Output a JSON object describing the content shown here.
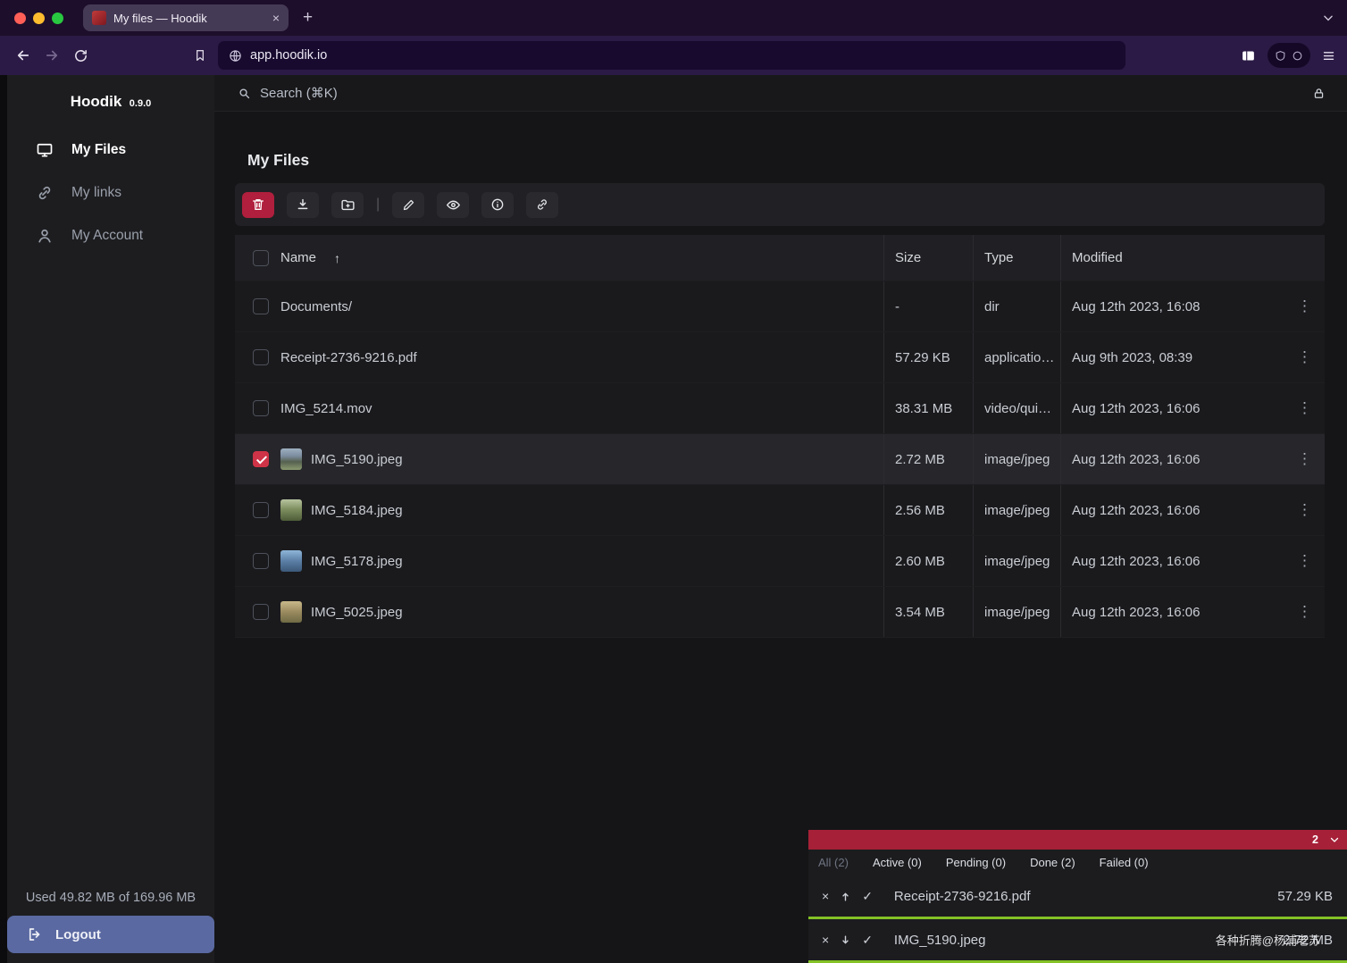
{
  "theme": {
    "delete_red": "#b01f3d",
    "transfer_header_red": "#a62037",
    "progress_green": "#84c226",
    "logout_blue": "#5a69a1",
    "checkbox_red": "#cf3347"
  },
  "glyphs": {
    "close": "×",
    "plus": "+",
    "kebab": "⋮",
    "sort_asc": "↑",
    "separator": "|",
    "check": "✓",
    "cancel": "×"
  },
  "browser": {
    "tab_title": "My files — Hoodik",
    "url": "app.hoodik.io"
  },
  "sidebar": {
    "brand": "Hoodik",
    "version": "0.9.0",
    "items": [
      {
        "label": "My Files"
      },
      {
        "label": "My links"
      },
      {
        "label": "My Account"
      }
    ],
    "usage": "Used 49.82 MB of 169.96 MB",
    "logout_label": "Logout"
  },
  "search": {
    "label": "Search (⌘K)"
  },
  "page": {
    "title": "My Files"
  },
  "files": {
    "columns": {
      "name": "Name",
      "size": "Size",
      "type": "Type",
      "modified": "Modified"
    },
    "rows": [
      {
        "name": "Documents/",
        "size": "-",
        "type": "dir",
        "modified": "Aug 12th 2023, 16:08"
      },
      {
        "name": "Receipt-2736-9216.pdf",
        "size": "57.29 KB",
        "type": "applicatio…",
        "modified": "Aug 9th 2023, 08:39"
      },
      {
        "name": "IMG_5214.mov",
        "size": "38.31 MB",
        "type": "video/qui…",
        "modified": "Aug 12th 2023, 16:06"
      },
      {
        "name": "IMG_5190.jpeg",
        "size": "2.72 MB",
        "type": "image/jpeg",
        "modified": "Aug 12th 2023, 16:06"
      },
      {
        "name": "IMG_5184.jpeg",
        "size": "2.56 MB",
        "type": "image/jpeg",
        "modified": "Aug 12th 2023, 16:06"
      },
      {
        "name": "IMG_5178.jpeg",
        "size": "2.60 MB",
        "type": "image/jpeg",
        "modified": "Aug 12th 2023, 16:06"
      },
      {
        "name": "IMG_5025.jpeg",
        "size": "3.54 MB",
        "type": "image/jpeg",
        "modified": "Aug 12th 2023, 16:06"
      }
    ]
  },
  "transfers": {
    "badge": "2",
    "tabs": [
      {
        "label": "All (2)"
      },
      {
        "label": "Active (0)"
      },
      {
        "label": "Pending (0)"
      },
      {
        "label": "Done (2)"
      },
      {
        "label": "Failed (0)"
      }
    ],
    "items": [
      {
        "name": "Receipt-2736-9216.pdf",
        "size": "57.29 KB"
      },
      {
        "name": "IMG_5190.jpeg",
        "size": "2.72 MB",
        "watermark": "各种折腾@杨浦老苏"
      }
    ]
  }
}
